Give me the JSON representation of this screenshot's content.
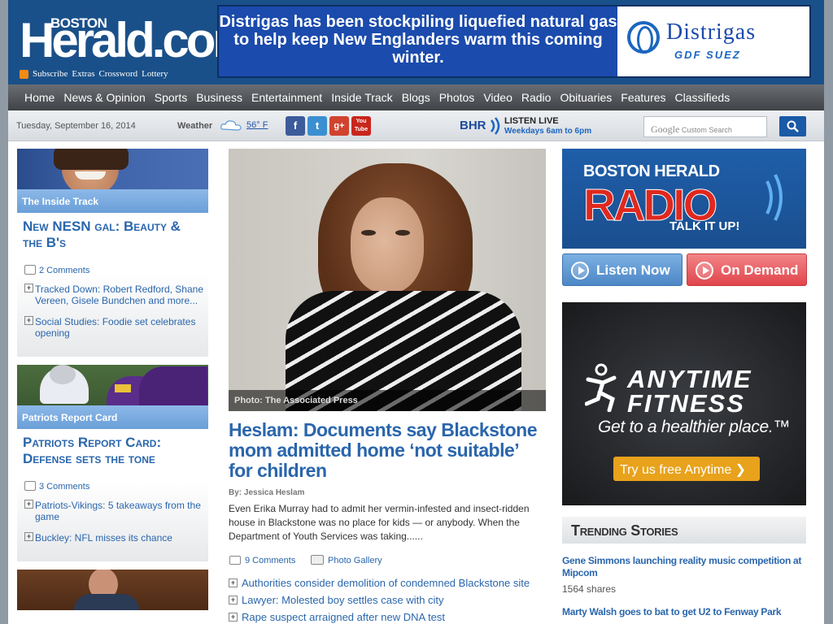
{
  "masthead": {
    "logo_top": "BOSTON",
    "logo_main": "Herald.com",
    "links": [
      "Subscribe",
      "Extras",
      "Crossword",
      "Lottery"
    ],
    "ad": {
      "message": "Distrigas has been stockpiling liquefied natural gas to help keep New Englanders warm this coming winter.",
      "brand_name": "Distrigas",
      "brand_sub": "GDF SUEZ"
    }
  },
  "nav": [
    "Home",
    "News & Opinion",
    "Sports",
    "Business",
    "Entertainment",
    "Inside Track",
    "Blogs",
    "Photos",
    "Video",
    "Radio",
    "Obituaries",
    "Features",
    "Classifieds"
  ],
  "subbar": {
    "date": "Tuesday, September 16, 2014",
    "weather_label": "Weather",
    "temperature": "56° F",
    "social": [
      "f",
      "t",
      "g+",
      "You Tube"
    ],
    "radio_logo": "BHR",
    "listen_live": "LISTEN LIVE",
    "listen_hours": "Weekdays 6am to 6pm",
    "search_brand": "Google",
    "search_placeholder": "Custom Search"
  },
  "left_cards": [
    {
      "tag": "The Inside Track",
      "headline": "New NESN gal: Beauty & the B's",
      "comments": "2 Comments",
      "links": [
        "Tracked Down: Robert Redford, Shane Vereen, Gisele Bundchen and more...",
        "Social Studies: Foodie set celebrates opening"
      ]
    },
    {
      "tag": "Patriots Report Card",
      "headline": "Patriots Report Card: Defense sets the tone",
      "comments": "3 Comments",
      "links": [
        "Patriots-Vikings: 5 takeaways from the game",
        "Buckley: NFL misses its chance"
      ]
    }
  ],
  "main": {
    "photo_credit": "Photo:  The Associated Press",
    "headline": "Heslam: Documents say Blackstone mom admitted home ‘not suitable’ for children",
    "byline": "By:  Jessica Heslam",
    "summary": "Even Erika Murray had to admit her vermin-infested and insect-ridden house in Blackstone was no place for kids — or anybody. When the Department of Youth Services was taking......",
    "comments": "9 Comments",
    "gallery": "Photo Gallery",
    "related": [
      "Authorities consider demolition of condemned Blackstone site",
      "Lawyer: Molested boy settles case with city",
      "Rape suspect arraigned after new DNA test"
    ]
  },
  "right": {
    "radio_top": "BOSTON HERALD",
    "radio_main": "RADIO",
    "radio_tag": "TALK IT UP!",
    "listen_now": "Listen Now",
    "on_demand": "On Demand",
    "fitness_name": "ANYTIME FITNESS",
    "fitness_tag": "Get to a healthier place.™",
    "fitness_cta": "Try us free Anytime ❯",
    "trending_title": "Trending Stories",
    "trending": [
      {
        "title": "Gene Simmons launching reality music competition at Mipcom",
        "shares": "1564 shares"
      },
      {
        "title": "Marty Walsh goes to bat to get U2 to Fenway Park",
        "shares": ""
      }
    ]
  }
}
